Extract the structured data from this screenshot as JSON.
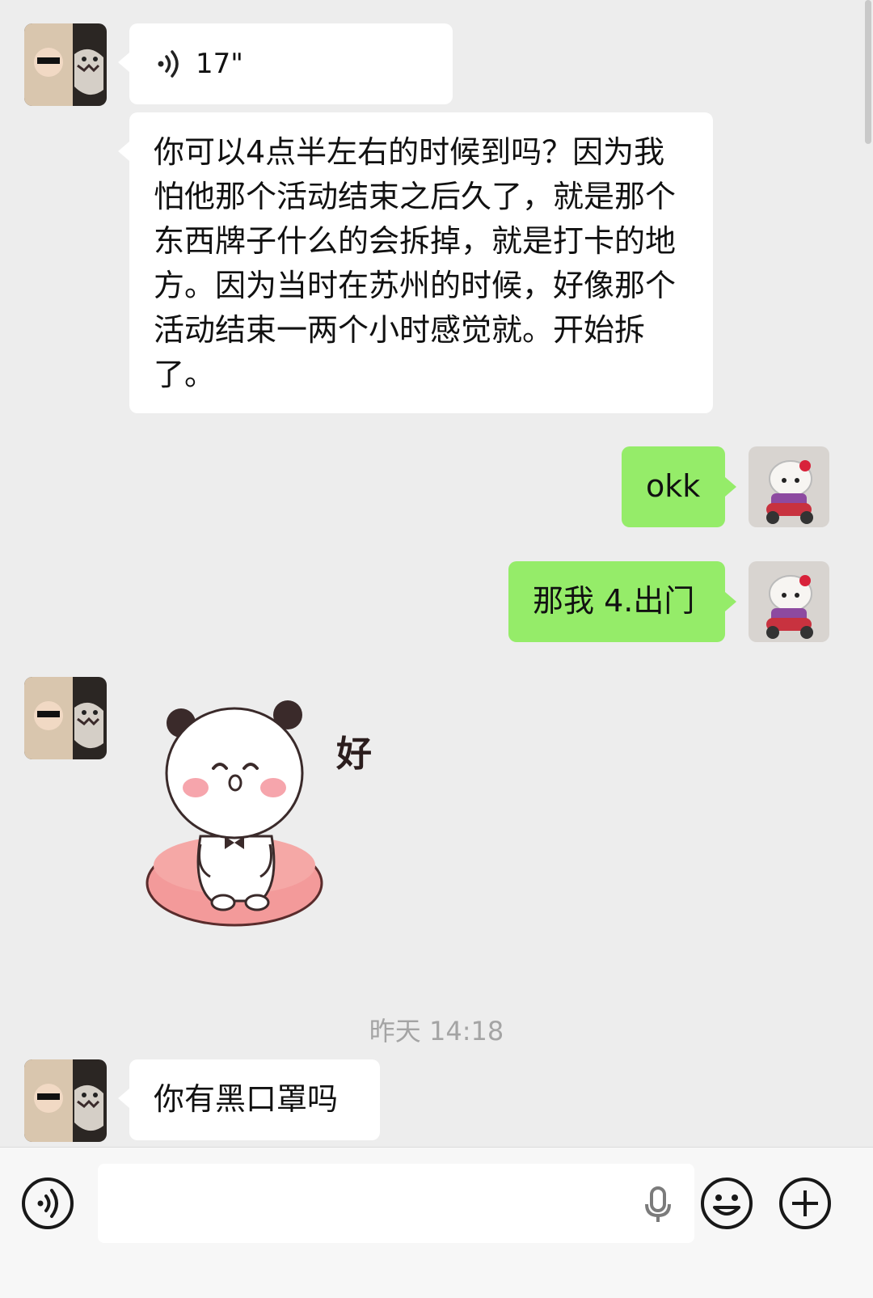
{
  "messages": [
    {
      "side": "left",
      "type": "voice",
      "duration": "17\"",
      "icon": "voice-wave-icon"
    },
    {
      "side": "left",
      "type": "text",
      "text": "你可以4点半左右的时候到吗？因为我怕他那个活动结束之后久了，就是那个东西牌子什么的会拆掉，就是打卡的地方。因为当时在苏州的时候，好像那个活动结束一两个小时感觉就。开始拆了。"
    },
    {
      "side": "right",
      "type": "text",
      "text": "okk"
    },
    {
      "side": "right",
      "type": "text",
      "text": "那我 4.出门"
    },
    {
      "side": "left",
      "type": "sticker",
      "caption": "好"
    },
    {
      "side": "left",
      "type": "text",
      "text": "你有黑口罩吗"
    }
  ],
  "timestamp": "昨天 14:18",
  "input_bar": {
    "value": "",
    "icons": [
      "voice-mode-icon",
      "microphone-icon",
      "emoji-icon",
      "plus-icon"
    ]
  },
  "colors": {
    "background": "#ededed",
    "bubble_other": "#ffffff",
    "bubble_self": "#95ec69",
    "timestamp": "#a4a4a4"
  }
}
